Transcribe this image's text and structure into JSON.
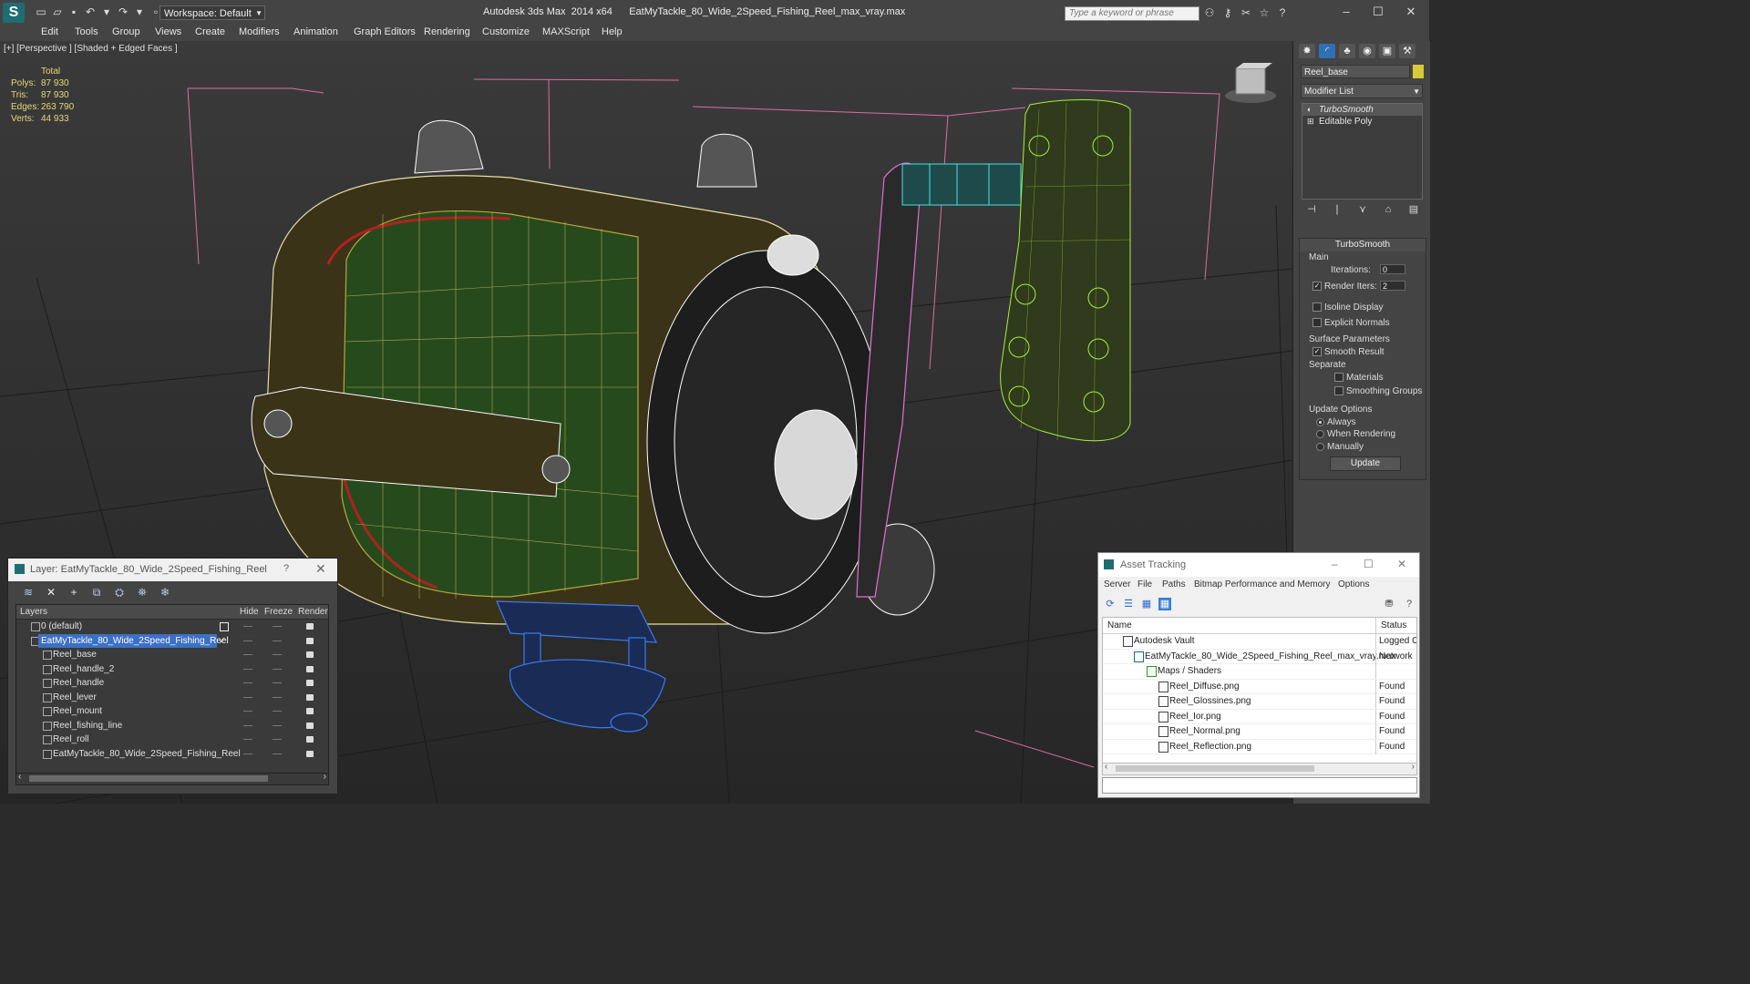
{
  "app": {
    "title": "Autodesk 3ds Max  2014 x64      EatMyTackle_80_Wide_2Speed_Fishing_Reel_max_vray.max",
    "workspace": "Workspace: Default",
    "search_placeholder": "Type a keyword or phrase"
  },
  "menu": [
    "Edit",
    "Tools",
    "Group",
    "Views",
    "Create",
    "Modifiers",
    "Animation",
    "Graph Editors",
    "Rendering",
    "Customize",
    "MAXScript",
    "Help"
  ],
  "viewport": {
    "label": "[+] [Perspective ] [Shaded + Edged Faces ]",
    "stats_header": "Total",
    "stats": [
      {
        "k": "Polys:",
        "v": "87 930"
      },
      {
        "k": "Tris:",
        "v": "87 930"
      },
      {
        "k": "Edges:",
        "v": "263 790"
      },
      {
        "k": "Verts:",
        "v": "44 933"
      }
    ]
  },
  "command_panel": {
    "object_name": "Reel_base",
    "modifier_list": "Modifier List",
    "stack": [
      "TurboSmooth",
      "Editable Poly"
    ],
    "rollout_title": "TurboSmooth",
    "main": "Main",
    "iterations_label": "Iterations:",
    "iterations": "0",
    "render_iters_label": "Render Iters:",
    "render_iters": "2",
    "isoline": "Isoline Display",
    "explicit_normals": "Explicit Normals",
    "surface_params": "Surface Parameters",
    "smooth_result": "Smooth Result",
    "separate": "Separate",
    "materials": "Materials",
    "smoothing_groups": "Smoothing Groups",
    "update_options": "Update Options",
    "always": "Always",
    "when_rendering": "When Rendering",
    "manually": "Manually",
    "update_btn": "Update"
  },
  "layer_window": {
    "title": "Layer: EatMyTackle_80_Wide_2Speed_Fishing_Reel",
    "help": "?",
    "col_layers": "Layers",
    "col_hide": "Hide",
    "col_freeze": "Freeze",
    "col_render": "Render",
    "rows": [
      "0 (default)",
      "EatMyTackle_80_Wide_2Speed_Fishing_Reel",
      "Reel_base",
      "Reel_handle_2",
      "Reel_handle",
      "Reel_lever",
      "Reel_mount",
      "Reel_fishing_line",
      "Reel_roll",
      "EatMyTackle_80_Wide_2Speed_Fishing_Reel"
    ]
  },
  "asset_window": {
    "title": "Asset Tracking",
    "menu": [
      "Server",
      "File",
      "Paths",
      "Bitmap Performance and Memory",
      "Options"
    ],
    "col_name": "Name",
    "col_status": "Status",
    "rows": [
      {
        "name": "Autodesk Vault",
        "status": "Logged O"
      },
      {
        "name": "EatMyTackle_80_Wide_2Speed_Fishing_Reel_max_vray.max",
        "status": "Network"
      },
      {
        "name": "Maps / Shaders",
        "status": ""
      },
      {
        "name": "Reel_Diffuse.png",
        "status": "Found"
      },
      {
        "name": "Reel_Glossines.png",
        "status": "Found"
      },
      {
        "name": "Reel_Ior.png",
        "status": "Found"
      },
      {
        "name": "Reel_Normal.png",
        "status": "Found"
      },
      {
        "name": "Reel_Reflection.png",
        "status": "Found"
      }
    ]
  }
}
